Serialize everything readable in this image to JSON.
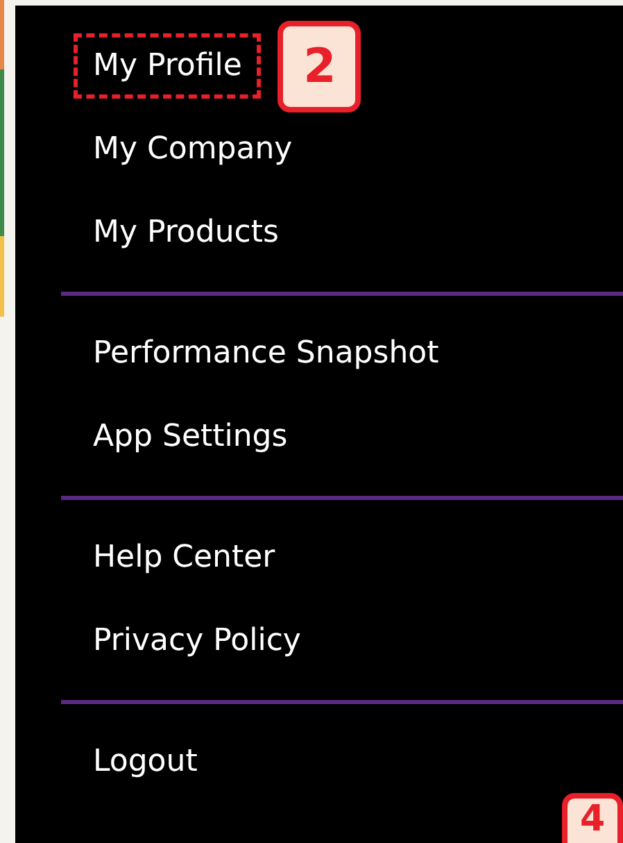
{
  "menu": {
    "sections": [
      {
        "items": [
          {
            "label": "My Profile",
            "highlighted": true
          },
          {
            "label": "My Company",
            "highlighted": false
          },
          {
            "label": "My Products",
            "highlighted": false
          }
        ]
      },
      {
        "items": [
          {
            "label": "Performance Snapshot",
            "highlighted": false
          },
          {
            "label": "App Settings",
            "highlighted": false
          }
        ]
      },
      {
        "items": [
          {
            "label": "Help Center",
            "highlighted": false
          },
          {
            "label": "Privacy Policy",
            "highlighted": false
          }
        ]
      },
      {
        "items": [
          {
            "label": "Logout",
            "highlighted": false
          }
        ]
      }
    ]
  },
  "step_badges": [
    {
      "label": "2",
      "kind": "beside-highlight"
    },
    {
      "label": "4",
      "kind": "corner"
    }
  ]
}
